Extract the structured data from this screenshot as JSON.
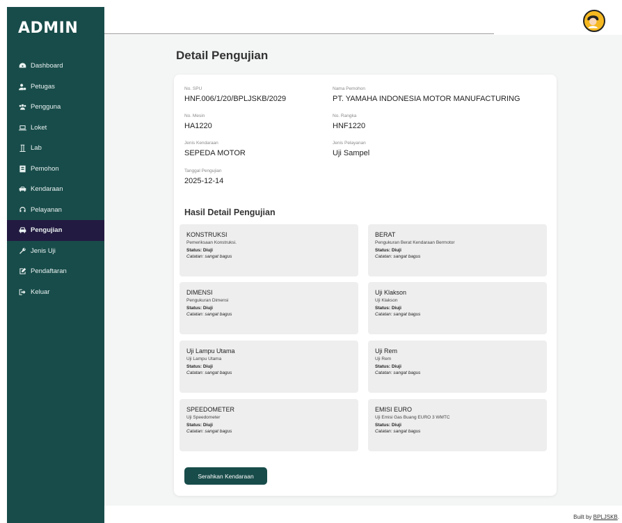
{
  "brand": "ADMIN",
  "sidebar": {
    "items": [
      {
        "label": "Dashboard",
        "icon": "dashboard-icon",
        "active": false
      },
      {
        "label": "Petugas",
        "icon": "users-cog-icon",
        "active": false
      },
      {
        "label": "Pengguna",
        "icon": "users-icon",
        "active": false
      },
      {
        "label": "Loket",
        "icon": "laptop-icon",
        "active": false
      },
      {
        "label": "Lab",
        "icon": "flask-icon",
        "active": false
      },
      {
        "label": "Pemohon",
        "icon": "id-card-icon",
        "active": false
      },
      {
        "label": "Kendaraan",
        "icon": "car-icon",
        "active": false
      },
      {
        "label": "Pelayanan",
        "icon": "headset-icon",
        "active": false
      },
      {
        "label": "Pengujian",
        "icon": "car-side-icon",
        "active": true
      },
      {
        "label": "Jenis Uji",
        "icon": "wrench-icon",
        "active": false
      },
      {
        "label": "Pendaftaran",
        "icon": "edit-icon",
        "active": false
      },
      {
        "label": "Keluar",
        "icon": "sign-out-icon",
        "active": false
      }
    ]
  },
  "page": {
    "title": "Detail Pengujian"
  },
  "detail": {
    "no_spu": {
      "label": "No. SPU",
      "value": "HNF.006/1/20/BPLJSKB/2029"
    },
    "nama_pemohon": {
      "label": "Nama Pemohon",
      "value": "PT. YAMAHA INDONESIA MOTOR MANUFACTURING"
    },
    "no_mesin": {
      "label": "No. Mesin",
      "value": "HA1220"
    },
    "no_rangka": {
      "label": "No. Rangka",
      "value": "HNF1220"
    },
    "jenis_kendaraan": {
      "label": "Jenis Kendaraan",
      "value": "SEPEDA MOTOR"
    },
    "jenis_pelayanan": {
      "label": "Jenis Pelayanan",
      "value": "Uji Sampel"
    },
    "tanggal_pengujian": {
      "label": "Tanggal Pengujian",
      "value": "2025-12-14"
    }
  },
  "results": {
    "title": "Hasil Detail Pengujian",
    "items": [
      {
        "name": "KONSTRUKSI",
        "desc": "Pemeriksaan Konstruksi.",
        "status": "Status: Diuji",
        "note": "Catatan: sangat bagus"
      },
      {
        "name": "BERAT",
        "desc": "Pengukuran Berat Kendaraan Bermotor",
        "status": "Status: Diuji",
        "note": "Catatan: sangat bagus"
      },
      {
        "name": "DIMENSI",
        "desc": "Pengukuran Dimensi",
        "status": "Status: Diuji",
        "note": "Catatan: sangat bagus"
      },
      {
        "name": "Uji Klakson",
        "desc": "Uji Klakson",
        "status": "Status: Diuji",
        "note": "Catatan: sangat bagus"
      },
      {
        "name": "Uji Lampu Utama",
        "desc": "Uji Lampu Utama",
        "status": "Status: Diuji",
        "note": "Catatan: sangat bagus"
      },
      {
        "name": "Uji Rem",
        "desc": "Uji Rem",
        "status": "Status: Diuji",
        "note": "Catatan: sangat bagus"
      },
      {
        "name": "SPEEDOMETER",
        "desc": "Uji Speedometer",
        "status": "Status: Diuji",
        "note": "Catatan: sangat bagus"
      },
      {
        "name": "EMISI EURO",
        "desc": "Uji Emisi Gas Buang EURO 3 WMTC",
        "status": "Status: Diuji",
        "note": "Catatan: sangat bagus"
      }
    ]
  },
  "actions": {
    "handover_label": "Serahkan Kendaraan"
  },
  "footer": {
    "prefix": "Built by ",
    "link": "BPLJSKB",
    "suffix": "."
  },
  "colors": {
    "sidebar": "#184c4a",
    "active": "#231a41",
    "accent": "#184c4a"
  }
}
